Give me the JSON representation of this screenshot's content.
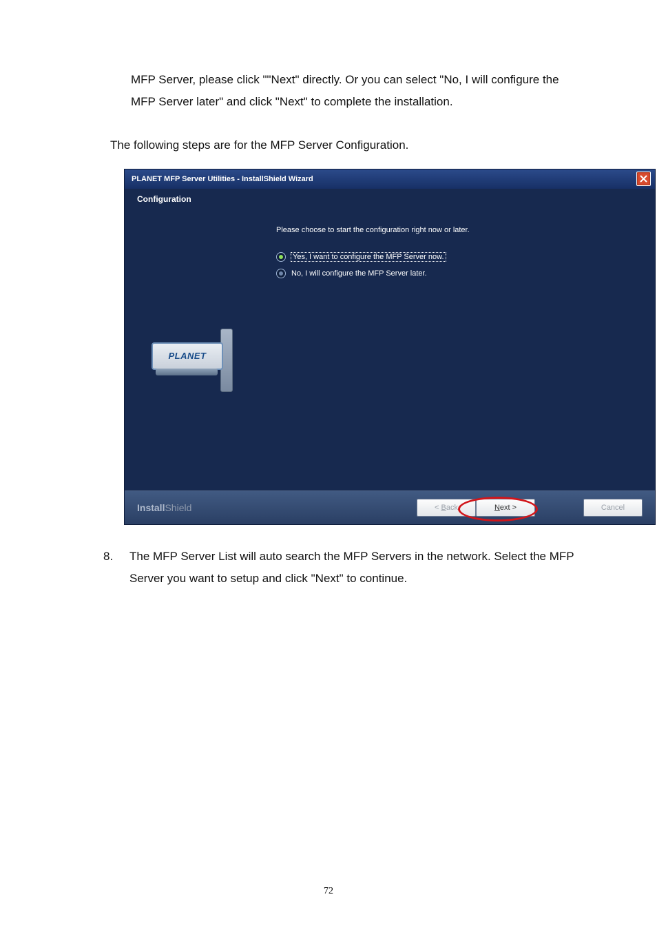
{
  "para1": "MFP Server, please click \"\"Next\" directly. Or you can select \"No, I will configure the MFP Server later\" and click \"Next\" to complete the installation.",
  "para2": "The following steps are for the MFP Server Configuration.",
  "installer": {
    "title": "PLANET MFP Server Utilities - InstallShield Wizard",
    "header": "Configuration",
    "instruction": "Please choose to start the configuration right now or later.",
    "option_yes": "Yes, I want to configure the MFP Server now.",
    "option_no": "No, I will configure the MFP Server later.",
    "brand_router": "PLANET",
    "footer_brand_main": "Install",
    "footer_brand_sub": "Shield",
    "btn_back_html": "< <u>B</u>ack",
    "btn_next_html": "<u>N</u>ext >",
    "btn_cancel": "Cancel"
  },
  "chart_data": {
    "type": "table",
    "title": "Wizard radio options",
    "options": [
      {
        "label": "Yes, I want to configure the MFP Server now.",
        "selected": true
      },
      {
        "label": "No, I will configure the MFP Server later.",
        "selected": false
      }
    ]
  },
  "step8": {
    "number": "8.",
    "text": "The MFP Server List will auto search the MFP Servers in the network. Select the MFP Server you want to setup and click \"Next\" to continue."
  },
  "page_number": "72"
}
